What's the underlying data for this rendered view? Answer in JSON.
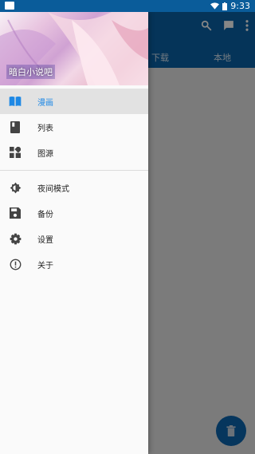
{
  "status": {
    "time": "9:33"
  },
  "appbar": {
    "tabs": [
      "下载",
      "本地"
    ]
  },
  "drawer": {
    "header_text": "暗白小说吧",
    "menu_primary": [
      {
        "label": "漫画",
        "icon": "book-open-icon",
        "active": true
      },
      {
        "label": "列表",
        "icon": "book-icon",
        "active": false
      },
      {
        "label": "图源",
        "icon": "dashboard-icon",
        "active": false
      }
    ],
    "menu_secondary": [
      {
        "label": "夜间模式",
        "icon": "brightness-icon"
      },
      {
        "label": "备份",
        "icon": "save-icon"
      },
      {
        "label": "设置",
        "icon": "gear-icon"
      },
      {
        "label": "关于",
        "icon": "info-icon"
      }
    ]
  },
  "colors": {
    "accent": "#1e88e5",
    "appbar": "#0b63a8",
    "fab": "#0d66b0"
  }
}
